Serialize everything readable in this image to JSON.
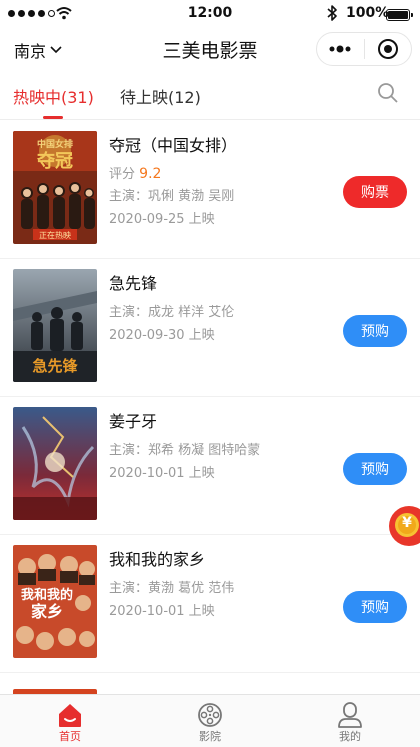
{
  "status_bar": {
    "time": "12:00",
    "battery": "100%"
  },
  "nav": {
    "city": "南京",
    "title": "三美电影票"
  },
  "tabs": [
    {
      "label": "热映中(31)",
      "active": true
    },
    {
      "label": "待上映(12)",
      "active": false
    }
  ],
  "movies": [
    {
      "title": "夺冠（中国女排）",
      "score_label": "评分",
      "score": "9.2",
      "cast": "主演：巩俐 黄渤 吴刚",
      "release": "2020-09-25 上映",
      "action": "购票",
      "poster_text": "中国女排 · 夺冠 · 正在热映"
    },
    {
      "title": "急先锋",
      "cast": "主演：成龙 样洋 艾伦",
      "release": "2020-09-30 上映",
      "action": "预购",
      "poster_text": "急先锋"
    },
    {
      "title": "姜子牙",
      "cast": "主演：郑希 杨凝 图特哈蒙",
      "release": "2020-10-01 上映",
      "action": "预购",
      "poster_text": ""
    },
    {
      "title": "我和我的家乡",
      "cast": "主演：黄渤 葛优 范伟",
      "release": "2020-10-01 上映",
      "action": "预购",
      "poster_text": "我和我的家乡"
    }
  ],
  "coupon": {
    "symbol": "¥"
  },
  "tabbar": [
    {
      "label": "首页",
      "icon": "home-icon",
      "active": true
    },
    {
      "label": "影院",
      "icon": "film-reel-icon",
      "active": false
    },
    {
      "label": "我的",
      "icon": "user-icon",
      "active": false
    }
  ],
  "colors": {
    "accent": "#e62e2e",
    "buy": "#ee2a2a",
    "presale": "#2f8ef7",
    "score": "#f5781e"
  }
}
